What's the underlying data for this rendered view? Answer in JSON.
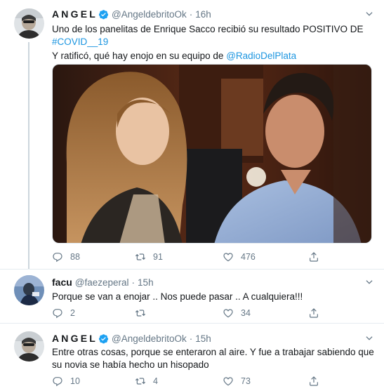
{
  "tweets": [
    {
      "name": "ANGEL",
      "handle": "@AngeldebritoOk",
      "dot": "·",
      "time": "16h",
      "text_line1": "Uno de los panelitas de Enrique Sacco recibió su resultado POSITIVO DE",
      "hashtag": "#COVID__19",
      "text_line3_prefix": "Y ratificó, qué hay enojo en su equipo de ",
      "mention": "@RadioDelPlata",
      "replies": "88",
      "retweets": "91",
      "likes": "476"
    },
    {
      "name": "facu",
      "handle": "@faezeperal",
      "dot": "·",
      "time": "15h",
      "text": "Porque se van a enojar .. Nos puede pasar .. A cualquiera!!!",
      "replies": "2",
      "retweets": "",
      "likes": "34"
    },
    {
      "name": "ANGEL",
      "handle": "@AngeldebritoOk",
      "dot": "·",
      "time": "15h",
      "text_line1": "Entre otras cosas, porque se enteraron al aire. Y fue a trabajar sabiendo que",
      "text_line2": "su novia se había hecho un hisopado",
      "replies": "10",
      "retweets": "4",
      "likes": "73"
    }
  ],
  "colors": {
    "link": "#1b95e0",
    "verified": "#1da1f2",
    "muted": "#657786",
    "text": "#14171a"
  },
  "icons": [
    "verified-icon",
    "chevron-down-icon",
    "reply-icon",
    "retweet-icon",
    "like-icon",
    "share-icon"
  ]
}
